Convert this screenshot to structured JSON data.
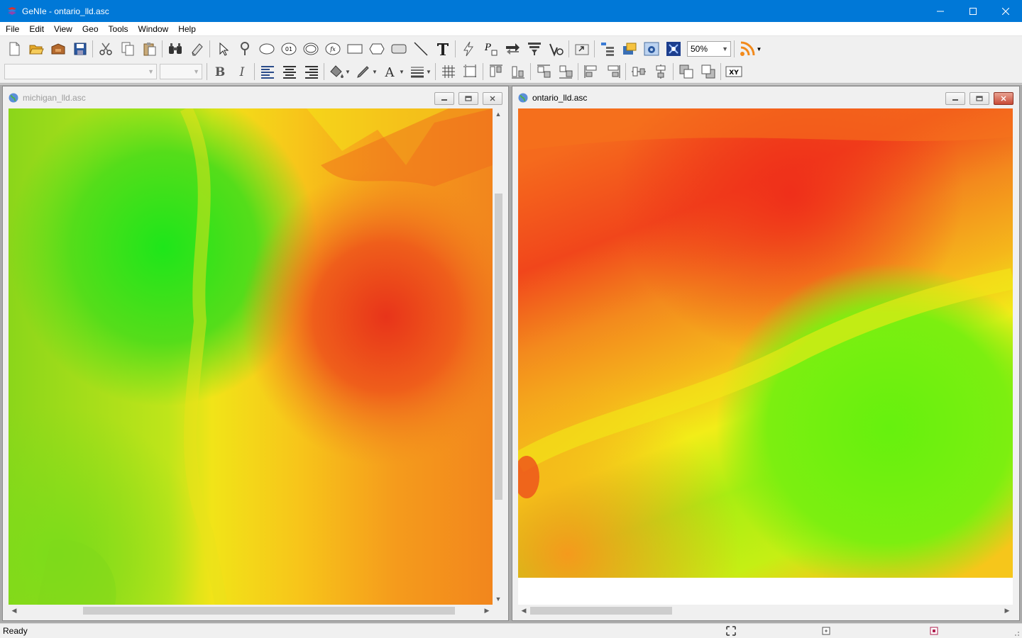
{
  "window": {
    "title": "GeNIe - ontario_lld.asc",
    "accent": "#0078d7"
  },
  "menu": [
    "File",
    "Edit",
    "View",
    "Geo",
    "Tools",
    "Window",
    "Help"
  ],
  "toolbar": {
    "zoom_value": "50%",
    "font_name_value": "",
    "font_size_value": "",
    "row1_icons": [
      "new-file-icon",
      "open-folder-icon",
      "open-archive-icon",
      "save-icon",
      "cut-icon",
      "copy-icon",
      "paste-icon",
      "find-icon",
      "eraser-icon",
      "select-pointer-icon",
      "probe-icon",
      "ellipse-tool-icon",
      "chance-node-icon",
      "deterministic-node-icon",
      "equation-node-icon",
      "rectangle-tool-icon",
      "hexagon-tool-icon",
      "rounded-rect-tool-icon",
      "arc-tool-icon",
      "text-tool-icon",
      "lightning-icon",
      "parameter-icon",
      "swap-arrows-icon",
      "filter-icon",
      "validate-icon",
      "export-icon",
      "tree-view-icon",
      "database-icon",
      "settings-panel-icon",
      "network-grid-icon",
      "rss-feed-icon"
    ],
    "row2_icons": [
      "bold-icon",
      "italic-icon",
      "align-left-icon",
      "align-center-icon",
      "align-right-icon",
      "fill-color-icon",
      "line-color-icon",
      "font-color-icon",
      "line-width-icon",
      "grid-icon",
      "snap-icon",
      "align-top-icon",
      "align-bottom-icon",
      "distribute-top-icon",
      "distribute-bottom-icon",
      "align-left-edge-icon",
      "align-right-edge-icon",
      "center-horizontal-icon",
      "center-vertical-icon",
      "bring-front-icon",
      "send-back-icon",
      "xy-coordinates-icon"
    ]
  },
  "windows": [
    {
      "title": "michigan_lld.asc",
      "active": false
    },
    {
      "title": "ontario_lld.asc",
      "active": true
    }
  ],
  "status": {
    "text": "Ready"
  }
}
